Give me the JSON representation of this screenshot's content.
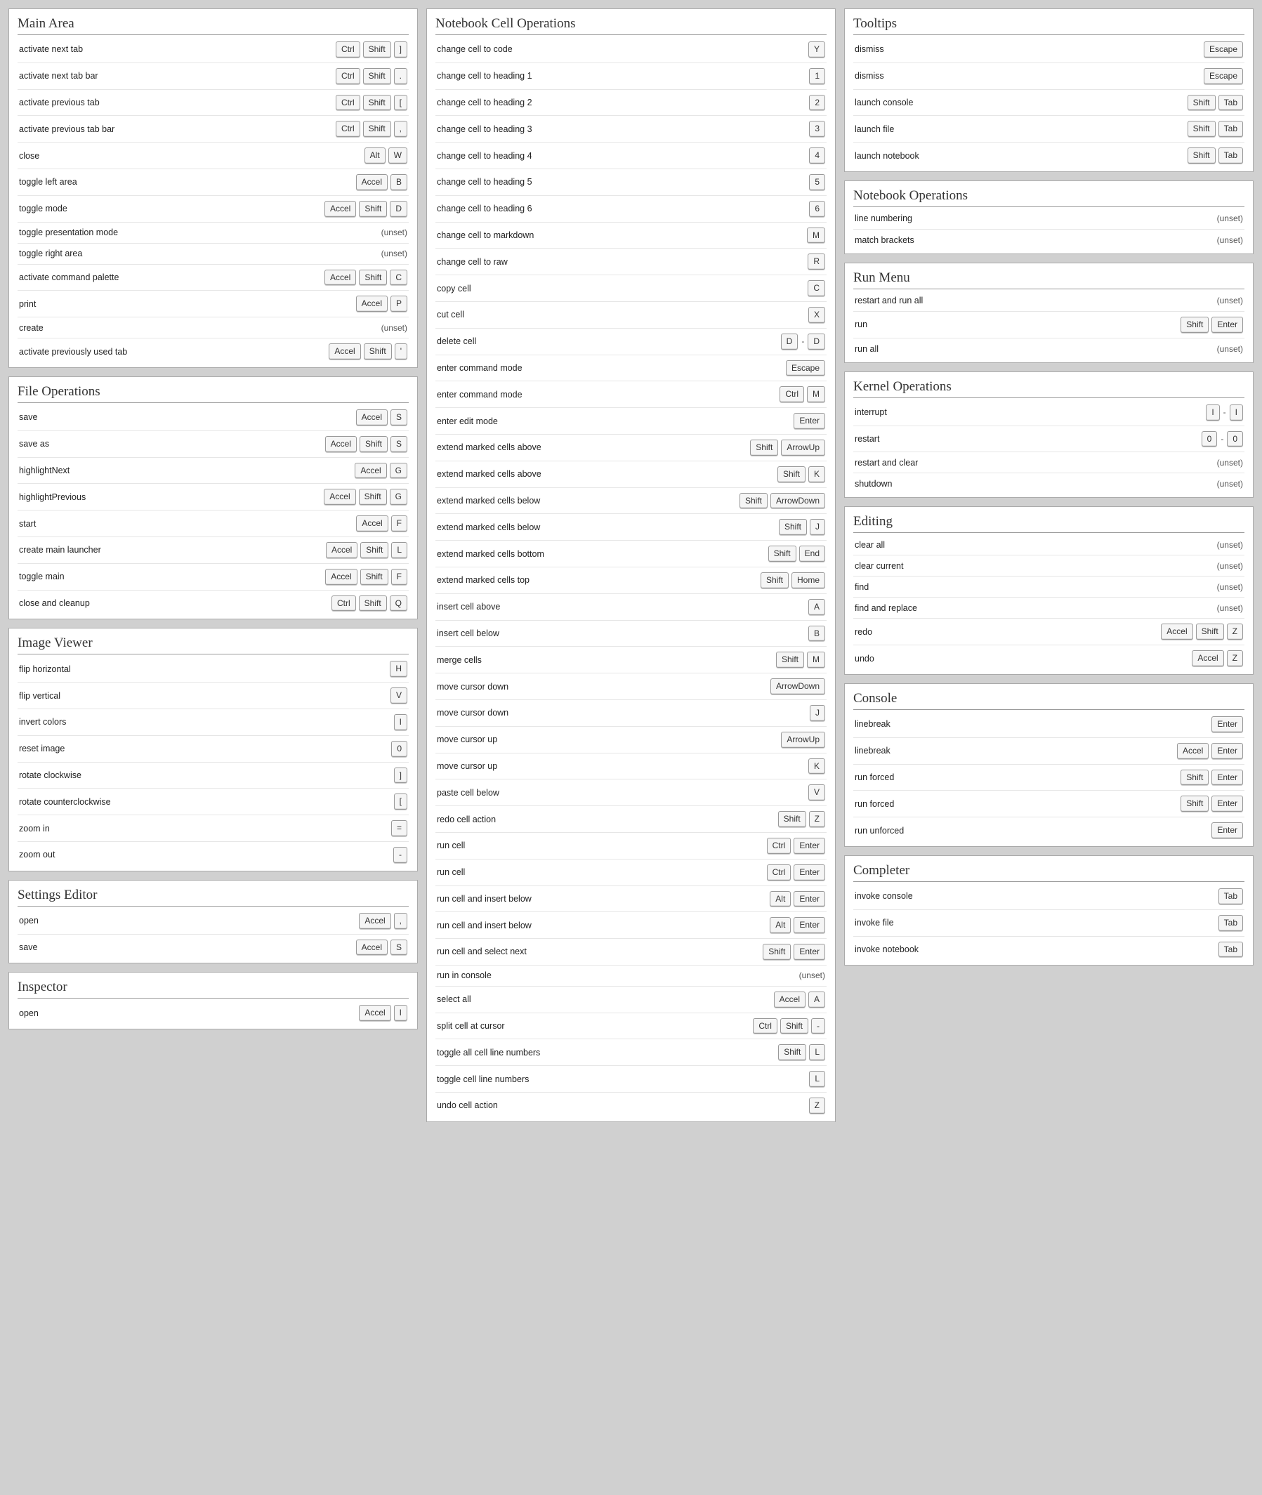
{
  "unset_label": "(unset)",
  "columns": [
    [
      {
        "title": "Main Area",
        "rows": [
          {
            "label": "activate next tab",
            "keys": [
              [
                "Ctrl",
                "Shift",
                "]"
              ]
            ]
          },
          {
            "label": "activate next tab bar",
            "keys": [
              [
                "Ctrl",
                "Shift",
                "."
              ]
            ]
          },
          {
            "label": "activate previous tab",
            "keys": [
              [
                "Ctrl",
                "Shift",
                "["
              ]
            ]
          },
          {
            "label": "activate previous tab bar",
            "keys": [
              [
                "Ctrl",
                "Shift",
                ","
              ]
            ]
          },
          {
            "label": "close",
            "keys": [
              [
                "Alt",
                "W"
              ]
            ]
          },
          {
            "label": "toggle left area",
            "keys": [
              [
                "Accel",
                "B"
              ]
            ]
          },
          {
            "label": "toggle mode",
            "keys": [
              [
                "Accel",
                "Shift",
                "D"
              ]
            ]
          },
          {
            "label": "toggle presentation mode",
            "unset": true
          },
          {
            "label": "toggle right area",
            "unset": true
          },
          {
            "label": "activate command palette",
            "keys": [
              [
                "Accel",
                "Shift",
                "C"
              ]
            ]
          },
          {
            "label": "print",
            "keys": [
              [
                "Accel",
                "P"
              ]
            ]
          },
          {
            "label": "create",
            "unset": true
          },
          {
            "label": "activate previously used tab",
            "keys": [
              [
                "Accel",
                "Shift",
                "'"
              ]
            ]
          }
        ]
      },
      {
        "title": "File Operations",
        "rows": [
          {
            "label": "save",
            "keys": [
              [
                "Accel",
                "S"
              ]
            ]
          },
          {
            "label": "save as",
            "keys": [
              [
                "Accel",
                "Shift",
                "S"
              ]
            ]
          },
          {
            "label": "highlightNext",
            "keys": [
              [
                "Accel",
                "G"
              ]
            ]
          },
          {
            "label": "highlightPrevious",
            "keys": [
              [
                "Accel",
                "Shift",
                "G"
              ]
            ]
          },
          {
            "label": "start",
            "keys": [
              [
                "Accel",
                "F"
              ]
            ]
          },
          {
            "label": "create main launcher",
            "keys": [
              [
                "Accel",
                "Shift",
                "L"
              ]
            ]
          },
          {
            "label": "toggle main",
            "keys": [
              [
                "Accel",
                "Shift",
                "F"
              ]
            ]
          },
          {
            "label": "close and cleanup",
            "keys": [
              [
                "Ctrl",
                "Shift",
                "Q"
              ]
            ]
          }
        ]
      },
      {
        "title": "Image Viewer",
        "rows": [
          {
            "label": "flip horizontal",
            "keys": [
              [
                "H"
              ]
            ]
          },
          {
            "label": "flip vertical",
            "keys": [
              [
                "V"
              ]
            ]
          },
          {
            "label": "invert colors",
            "keys": [
              [
                "I"
              ]
            ]
          },
          {
            "label": "reset image",
            "keys": [
              [
                "0"
              ]
            ]
          },
          {
            "label": "rotate clockwise",
            "keys": [
              [
                "]"
              ]
            ]
          },
          {
            "label": "rotate counterclockwise",
            "keys": [
              [
                "["
              ]
            ]
          },
          {
            "label": "zoom in",
            "keys": [
              [
                "="
              ]
            ]
          },
          {
            "label": "zoom out",
            "keys": [
              [
                "-"
              ]
            ]
          }
        ]
      },
      {
        "title": "Settings Editor",
        "rows": [
          {
            "label": "open",
            "keys": [
              [
                "Accel",
                ","
              ]
            ]
          },
          {
            "label": "save",
            "keys": [
              [
                "Accel",
                "S"
              ]
            ]
          }
        ]
      },
      {
        "title": "Inspector",
        "rows": [
          {
            "label": "open",
            "keys": [
              [
                "Accel",
                "I"
              ]
            ]
          }
        ]
      }
    ],
    [
      {
        "title": "Notebook Cell Operations",
        "rows": [
          {
            "label": "change cell to code",
            "keys": [
              [
                "Y"
              ]
            ]
          },
          {
            "label": "change cell to heading 1",
            "keys": [
              [
                "1"
              ]
            ]
          },
          {
            "label": "change cell to heading 2",
            "keys": [
              [
                "2"
              ]
            ]
          },
          {
            "label": "change cell to heading 3",
            "keys": [
              [
                "3"
              ]
            ]
          },
          {
            "label": "change cell to heading 4",
            "keys": [
              [
                "4"
              ]
            ]
          },
          {
            "label": "change cell to heading 5",
            "keys": [
              [
                "5"
              ]
            ]
          },
          {
            "label": "change cell to heading 6",
            "keys": [
              [
                "6"
              ]
            ]
          },
          {
            "label": "change cell to markdown",
            "keys": [
              [
                "M"
              ]
            ]
          },
          {
            "label": "change cell to raw",
            "keys": [
              [
                "R"
              ]
            ]
          },
          {
            "label": "copy cell",
            "keys": [
              [
                "C"
              ]
            ]
          },
          {
            "label": "cut cell",
            "keys": [
              [
                "X"
              ]
            ]
          },
          {
            "label": "delete cell",
            "keys": [
              [
                "D"
              ],
              [
                "D"
              ]
            ]
          },
          {
            "label": "enter command mode",
            "keys": [
              [
                "Escape"
              ]
            ]
          },
          {
            "label": "enter command mode",
            "keys": [
              [
                "Ctrl",
                "M"
              ]
            ]
          },
          {
            "label": "enter edit mode",
            "keys": [
              [
                "Enter"
              ]
            ]
          },
          {
            "label": "extend marked cells above",
            "keys": [
              [
                "Shift",
                "ArrowUp"
              ]
            ]
          },
          {
            "label": "extend marked cells above",
            "keys": [
              [
                "Shift",
                "K"
              ]
            ]
          },
          {
            "label": "extend marked cells below",
            "keys": [
              [
                "Shift",
                "ArrowDown"
              ]
            ]
          },
          {
            "label": "extend marked cells below",
            "keys": [
              [
                "Shift",
                "J"
              ]
            ]
          },
          {
            "label": "extend marked cells bottom",
            "keys": [
              [
                "Shift",
                "End"
              ]
            ]
          },
          {
            "label": "extend marked cells top",
            "keys": [
              [
                "Shift",
                "Home"
              ]
            ]
          },
          {
            "label": "insert cell above",
            "keys": [
              [
                "A"
              ]
            ]
          },
          {
            "label": "insert cell below",
            "keys": [
              [
                "B"
              ]
            ]
          },
          {
            "label": "merge cells",
            "keys": [
              [
                "Shift",
                "M"
              ]
            ]
          },
          {
            "label": "move cursor down",
            "keys": [
              [
                "ArrowDown"
              ]
            ]
          },
          {
            "label": "move cursor down",
            "keys": [
              [
                "J"
              ]
            ]
          },
          {
            "label": "move cursor up",
            "keys": [
              [
                "ArrowUp"
              ]
            ]
          },
          {
            "label": "move cursor up",
            "keys": [
              [
                "K"
              ]
            ]
          },
          {
            "label": "paste cell below",
            "keys": [
              [
                "V"
              ]
            ]
          },
          {
            "label": "redo cell action",
            "keys": [
              [
                "Shift",
                "Z"
              ]
            ]
          },
          {
            "label": "run cell",
            "keys": [
              [
                "Ctrl",
                "Enter"
              ]
            ]
          },
          {
            "label": "run cell",
            "keys": [
              [
                "Ctrl",
                "Enter"
              ]
            ]
          },
          {
            "label": "run cell and insert below",
            "keys": [
              [
                "Alt",
                "Enter"
              ]
            ]
          },
          {
            "label": "run cell and insert below",
            "keys": [
              [
                "Alt",
                "Enter"
              ]
            ]
          },
          {
            "label": "run cell and select next",
            "keys": [
              [
                "Shift",
                "Enter"
              ]
            ]
          },
          {
            "label": "run in console",
            "unset": true
          },
          {
            "label": "select all",
            "keys": [
              [
                "Accel",
                "A"
              ]
            ]
          },
          {
            "label": "split cell at cursor",
            "keys": [
              [
                "Ctrl",
                "Shift",
                "-"
              ]
            ]
          },
          {
            "label": "toggle all cell line numbers",
            "keys": [
              [
                "Shift",
                "L"
              ]
            ]
          },
          {
            "label": "toggle cell line numbers",
            "keys": [
              [
                "L"
              ]
            ]
          },
          {
            "label": "undo cell action",
            "keys": [
              [
                "Z"
              ]
            ]
          }
        ]
      }
    ],
    [
      {
        "title": "Tooltips",
        "rows": [
          {
            "label": "dismiss",
            "keys": [
              [
                "Escape"
              ]
            ]
          },
          {
            "label": "dismiss",
            "keys": [
              [
                "Escape"
              ]
            ]
          },
          {
            "label": "launch console",
            "keys": [
              [
                "Shift",
                "Tab"
              ]
            ]
          },
          {
            "label": "launch file",
            "keys": [
              [
                "Shift",
                "Tab"
              ]
            ]
          },
          {
            "label": "launch notebook",
            "keys": [
              [
                "Shift",
                "Tab"
              ]
            ]
          }
        ]
      },
      {
        "title": "Notebook Operations",
        "rows": [
          {
            "label": "line numbering",
            "unset": true
          },
          {
            "label": "match brackets",
            "unset": true
          }
        ]
      },
      {
        "title": "Run Menu",
        "rows": [
          {
            "label": "restart and run all",
            "unset": true
          },
          {
            "label": "run",
            "keys": [
              [
                "Shift",
                "Enter"
              ]
            ]
          },
          {
            "label": "run all",
            "unset": true
          }
        ]
      },
      {
        "title": "Kernel Operations",
        "rows": [
          {
            "label": "interrupt",
            "keys": [
              [
                "I"
              ],
              [
                "I"
              ]
            ]
          },
          {
            "label": "restart",
            "keys": [
              [
                "0"
              ],
              [
                "0"
              ]
            ]
          },
          {
            "label": "restart and clear",
            "unset": true
          },
          {
            "label": "shutdown",
            "unset": true
          }
        ]
      },
      {
        "title": "Editing",
        "rows": [
          {
            "label": "clear all",
            "unset": true
          },
          {
            "label": "clear current",
            "unset": true
          },
          {
            "label": "find",
            "unset": true
          },
          {
            "label": "find and replace",
            "unset": true
          },
          {
            "label": "redo",
            "keys": [
              [
                "Accel",
                "Shift",
                "Z"
              ]
            ]
          },
          {
            "label": "undo",
            "keys": [
              [
                "Accel",
                "Z"
              ]
            ]
          }
        ]
      },
      {
        "title": "Console",
        "rows": [
          {
            "label": "linebreak",
            "keys": [
              [
                "Enter"
              ]
            ]
          },
          {
            "label": "linebreak",
            "keys": [
              [
                "Accel",
                "Enter"
              ]
            ]
          },
          {
            "label": "run forced",
            "keys": [
              [
                "Shift",
                "Enter"
              ]
            ]
          },
          {
            "label": "run forced",
            "keys": [
              [
                "Shift",
                "Enter"
              ]
            ]
          },
          {
            "label": "run unforced",
            "keys": [
              [
                "Enter"
              ]
            ]
          }
        ]
      },
      {
        "title": "Completer",
        "rows": [
          {
            "label": "invoke console",
            "keys": [
              [
                "Tab"
              ]
            ]
          },
          {
            "label": "invoke file",
            "keys": [
              [
                "Tab"
              ]
            ]
          },
          {
            "label": "invoke notebook",
            "keys": [
              [
                "Tab"
              ]
            ]
          }
        ]
      }
    ]
  ]
}
